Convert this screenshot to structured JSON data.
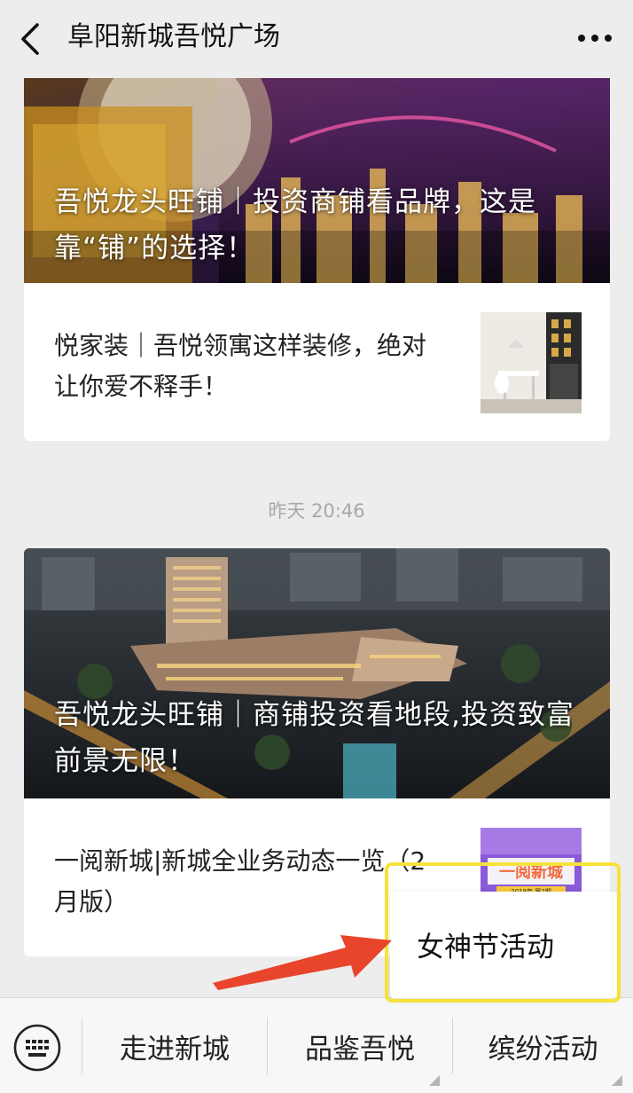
{
  "header": {
    "title": "阜阳新城吾悦广场",
    "back_icon": "chevron-left-icon",
    "more_icon": "more-dots-icon"
  },
  "feed": {
    "card1": {
      "hero_title": "吾悦龙头旺铺｜投资商铺看品牌，这是靠“铺”的选择！",
      "item_text": "悦家装｜吾悦领寓这样装修，绝对让你爱不释手！"
    },
    "timestamp": "昨天 20:46",
    "card2": {
      "hero_title": "吾悦龙头旺铺｜商铺投资看地段,投资致富前景无限！",
      "item_text": "一阅新城|新城全业务动态一览（2月版）",
      "thumb_text": "一阅新城",
      "thumb_subtext": "2019年 第2期"
    }
  },
  "popup": {
    "label": "女神节活动",
    "highlight_color": "#f7e23b",
    "arrow_color": "#e8452c"
  },
  "menu": {
    "keyboard_icon": "keyboard-icon",
    "items": [
      {
        "label": "走进新城"
      },
      {
        "label": "品鉴吾悦"
      },
      {
        "label": "缤纷活动"
      }
    ]
  }
}
